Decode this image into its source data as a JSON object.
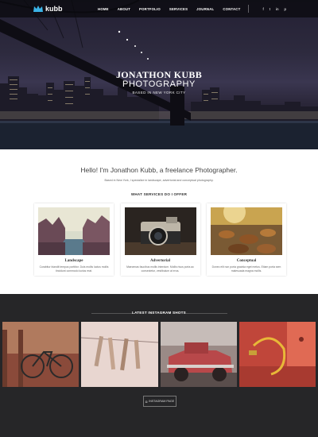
{
  "brand": {
    "logo_text": "kubb",
    "accent": "#3bb3e6"
  },
  "nav": {
    "items": [
      "HOME",
      "ABOUT",
      "PORTFOLIO",
      "SERVICES",
      "JOURNAL",
      "CONTACT"
    ]
  },
  "social": [
    "f",
    "t",
    "in",
    "p"
  ],
  "hero": {
    "name": "JONATHON KUBB",
    "title": "PHOTOGRAPHY",
    "subtitle": "BASED IN NEW YORK CITY"
  },
  "intro": {
    "heading": "Hello! I'm Jonathon Kubb, a freelance Photographer.",
    "sub": "Based in New York, I specialize in landscape, advertorial and conceptual photography."
  },
  "services": {
    "title": "WHAT SERVICES DO I OFFER",
    "cards": [
      {
        "title": "Landscape",
        "text": "Curabitur blandit tempus porttitor. Duis mollis luctus mollis tincidunt commodo luctus erat."
      },
      {
        "title": "Advertorial",
        "text": "Maecenas faucibus mollis interdum. Mollis risus porta ac consectetur, vestibulum at eros."
      },
      {
        "title": "Conceptual",
        "text": "Donec elit non porta gravida eget metus. Etiam porta sem malesuada magna mollis."
      }
    ]
  },
  "instagram": {
    "title": "LATEST INSTAGRAM SHOTS",
    "button": "INSTAGRAM PAGE",
    "button_icon": "camera-icon"
  }
}
